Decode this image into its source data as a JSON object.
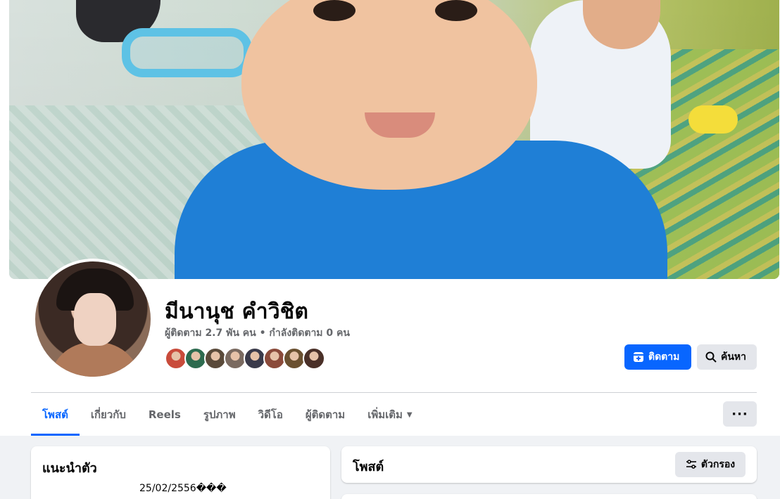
{
  "profile": {
    "name": "มีนานุช คำวิชิต",
    "stats": "ผู้ติดตาม 2.7 พัน คน • กำลังติดตาม 0 คน",
    "friend_avatar_colors": [
      "#c94b3b",
      "#2d6b4f",
      "#5a4a3a",
      "#7a6a60",
      "#3a3a4a",
      "#8a4a3a",
      "#6a5030",
      "#4a3028"
    ]
  },
  "actions": {
    "follow": "ติดตาม",
    "search": "ค้นหา"
  },
  "tabs": [
    {
      "label": "โพสต์",
      "active": true
    },
    {
      "label": "เกี่ยวกับ"
    },
    {
      "label": "Reels"
    },
    {
      "label": "รูปภาพ"
    },
    {
      "label": "วิดีโอ"
    },
    {
      "label": "ผู้ติดตาม"
    },
    {
      "label": "เพิ่มเติม"
    }
  ],
  "more_button": "···",
  "intro": {
    "title": "แนะนำตัว",
    "date": "25/02/2556���"
  },
  "posts": {
    "title": "โพสต์",
    "filter": "ตัวกรอง"
  },
  "colors": {
    "accent": "#0866ff",
    "button_gray": "#e4e6eb",
    "muted_text": "#65676b",
    "background": "#f0f2f5"
  }
}
